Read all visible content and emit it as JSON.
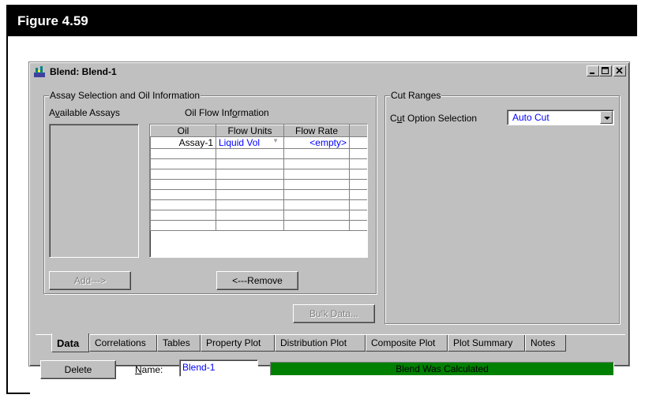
{
  "figure": {
    "label": "Figure 4.59"
  },
  "window": {
    "title": "Blend: Blend-1",
    "minimize_label": "_",
    "maximize_label": "□",
    "close_label": "×"
  },
  "assay_group": {
    "legend": "Assay Selection and Oil Information",
    "available_assays_label": "Available Assays",
    "oil_flow_label": "Oil Flow Information",
    "columns": [
      "Oil",
      "Flow Units",
      "Flow Rate"
    ],
    "rows": [
      {
        "oil": "Assay-1",
        "flow_units": "Liquid Vol",
        "flow_rate": "<empty>"
      }
    ],
    "add_button": "Add--->",
    "remove_button": "<---Remove"
  },
  "bulk_data_button": "Bulk Data...",
  "cut_ranges": {
    "legend": "Cut Ranges",
    "option_label": "Cut Option Selection",
    "option_value": "Auto Cut"
  },
  "tabs": [
    "Data",
    "Correlations",
    "Tables",
    "Property Plot",
    "Distribution Plot",
    "Composite Plot",
    "Plot Summary",
    "Notes"
  ],
  "active_tab": "Data",
  "footer": {
    "delete_button": "Delete",
    "name_label": "Name:",
    "name_value": "Blend-1",
    "status_text": "Blend Was Calculated",
    "status_color": "#008000"
  }
}
